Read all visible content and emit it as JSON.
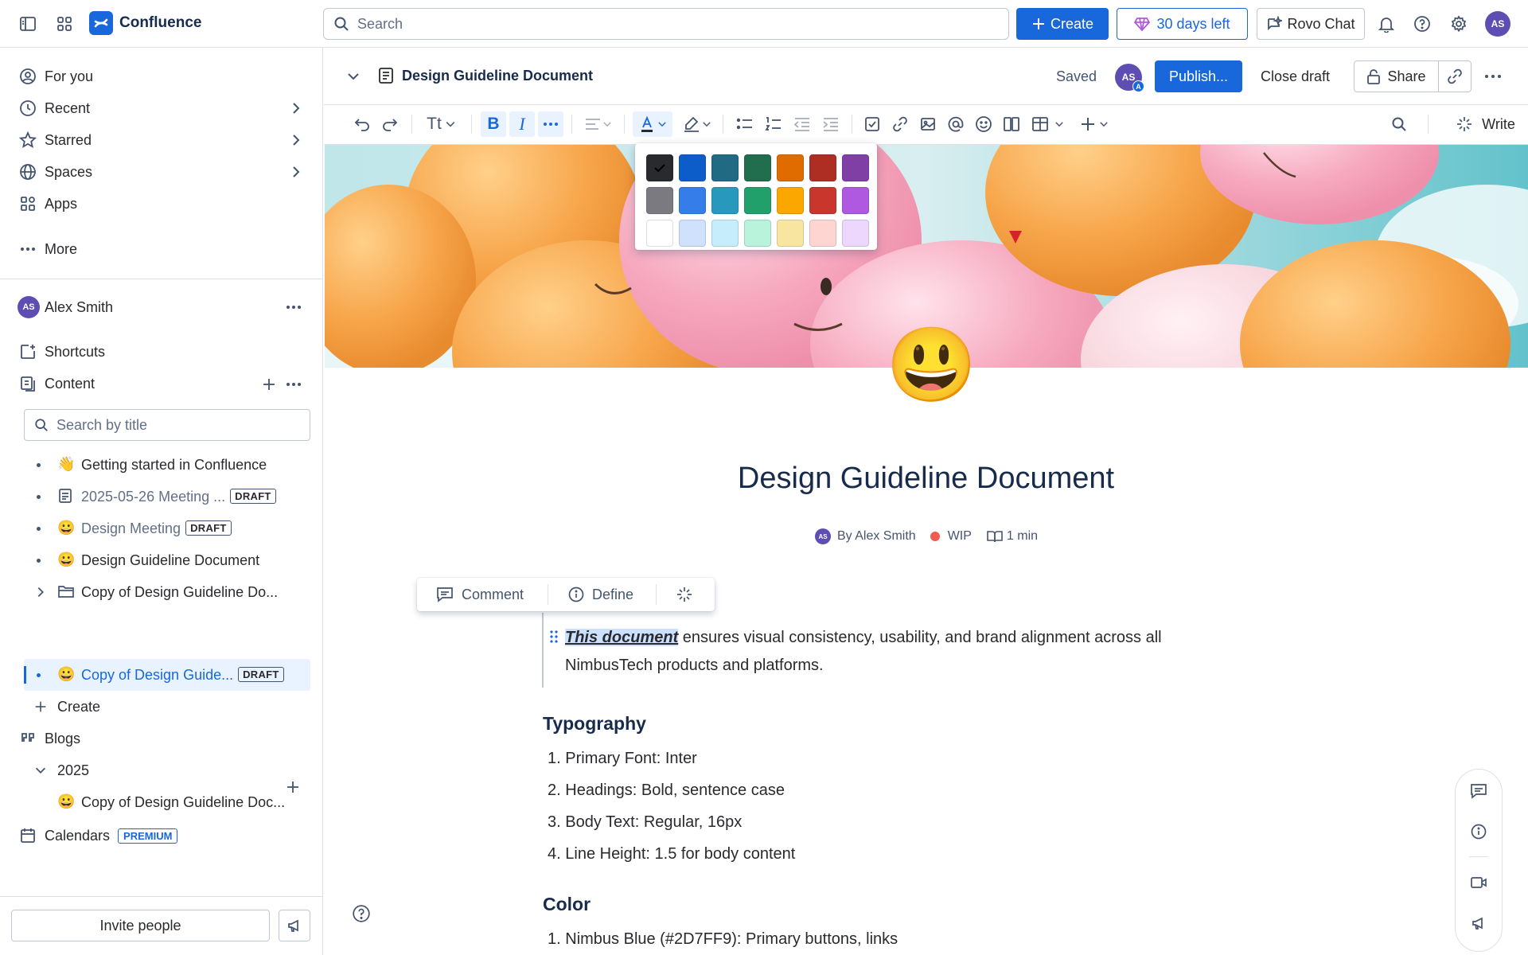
{
  "topbar": {
    "app_name": "Confluence",
    "search_placeholder": "Search",
    "create_label": "Create",
    "trial_label": "30 days left",
    "rovo_label": "Rovo Chat",
    "avatar_initials": "AS"
  },
  "sidebar": {
    "nav": [
      {
        "label": "For you",
        "icon": "person-circle-icon"
      },
      {
        "label": "Recent",
        "icon": "clock-icon"
      },
      {
        "label": "Starred",
        "icon": "star-icon"
      },
      {
        "label": "Spaces",
        "icon": "globe-icon"
      },
      {
        "label": "Apps",
        "icon": "apps-icon"
      },
      {
        "label": "More",
        "icon": "more-dots-icon"
      }
    ],
    "space_owner": "Alex Smith",
    "space_avatar": "AS",
    "shortcuts_label": "Shortcuts",
    "content_label": "Content",
    "search_placeholder": "Search by title",
    "tree": [
      {
        "emoji": "👋",
        "title": "Getting started in Confluence",
        "badge": ""
      },
      {
        "emoji": "",
        "title": "2025-05-26 Meeting ...",
        "badge": "DRAFT"
      },
      {
        "emoji": "😀",
        "title": "Design Meeting",
        "badge": "DRAFT"
      },
      {
        "emoji": "😀",
        "title": "Design Guideline Document",
        "badge": ""
      },
      {
        "emoji": "",
        "title": "Copy of Design Guideline Do...",
        "badge": ""
      },
      {
        "emoji": "😀",
        "title": "Copy of Design Guide...",
        "badge": "DRAFT"
      }
    ],
    "create_label": "Create",
    "blogs_label": "Blogs",
    "blog_year": "2025",
    "blog_post": {
      "emoji": "😀",
      "title": "Copy of Design Guideline Doc..."
    },
    "calendars_label": "Calendars",
    "premium_badge": "PREMIUM",
    "invite_label": "Invite people"
  },
  "pagebar": {
    "title": "Design Guideline Document",
    "saved_label": "Saved",
    "avatar_initials": "AS",
    "avatar_sub": "A",
    "publish_label": "Publish...",
    "close_draft_label": "Close draft",
    "share_label": "Share"
  },
  "toolbar": {
    "text_style_label": "Tt",
    "write_label": "Write"
  },
  "palette": {
    "rows": [
      [
        "#292A2E",
        "#0C5CC9",
        "#206A83",
        "#216E4E",
        "#E06C00",
        "#AE2E24",
        "#803FA5"
      ],
      [
        "#7A7A80",
        "#357DE8",
        "#2898BD",
        "#22A06B",
        "#FCA700",
        "#C9372C",
        "#AF59E1"
      ],
      [
        "#FFFFFF",
        "#CFE1FD",
        "#C6EDFB",
        "#BAF3DB",
        "#F8E6A0",
        "#FFD5D2",
        "#EED7FC"
      ]
    ],
    "selected": "#292A2E"
  },
  "document": {
    "emoji": "😃",
    "title": "Design Guideline Document",
    "byline_avatar": "AS",
    "byline": "By Alex Smith",
    "status": "WIP",
    "status_color": "#F15B50",
    "read_time": "1 min",
    "selection_toolbar": {
      "comment": "Comment",
      "define": "Define"
    },
    "intro_selected": "This document",
    "intro_rest": " ensures visual consistency, usability, and brand alignment across all NimbusTech products and platforms.",
    "typography_heading": "Typography",
    "typography_items": [
      "Primary Font: Inter",
      "Headings: Bold, sentence case",
      "Body Text: Regular, 16px",
      "Line Height: 1.5 for body content"
    ],
    "color_heading": "Color",
    "color_items": [
      "Nimbus Blue (#2D7FF9): Primary buttons, links"
    ]
  },
  "colors": {
    "brand": "#1868DB",
    "selection": "#CCE0FF",
    "avatar": "#5E4DB2"
  }
}
